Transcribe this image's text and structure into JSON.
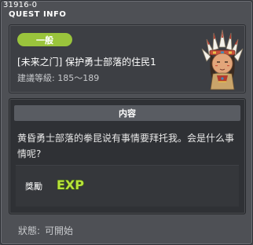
{
  "window": {
    "quest_id": "31916-0",
    "title": "QUEST INFO"
  },
  "info": {
    "category": "一般",
    "quest_name": "[未来之门] 保护勇士部落的住民1",
    "level_range": "建議等級: 185～189",
    "npc_icon": "npc-chief-portrait"
  },
  "content": {
    "header": "内容",
    "text": "黄昏勇士部落的拳昆说有事情要拜托我。会是什么事情呢?",
    "reward_label": "獎勵",
    "reward_icon": "exp-icon",
    "reward_text": "EXP"
  },
  "status": {
    "label": "狀態:",
    "value": "可開始"
  },
  "colors": {
    "badge": "#9ac43c",
    "exp_fill": "#b7e23a"
  }
}
